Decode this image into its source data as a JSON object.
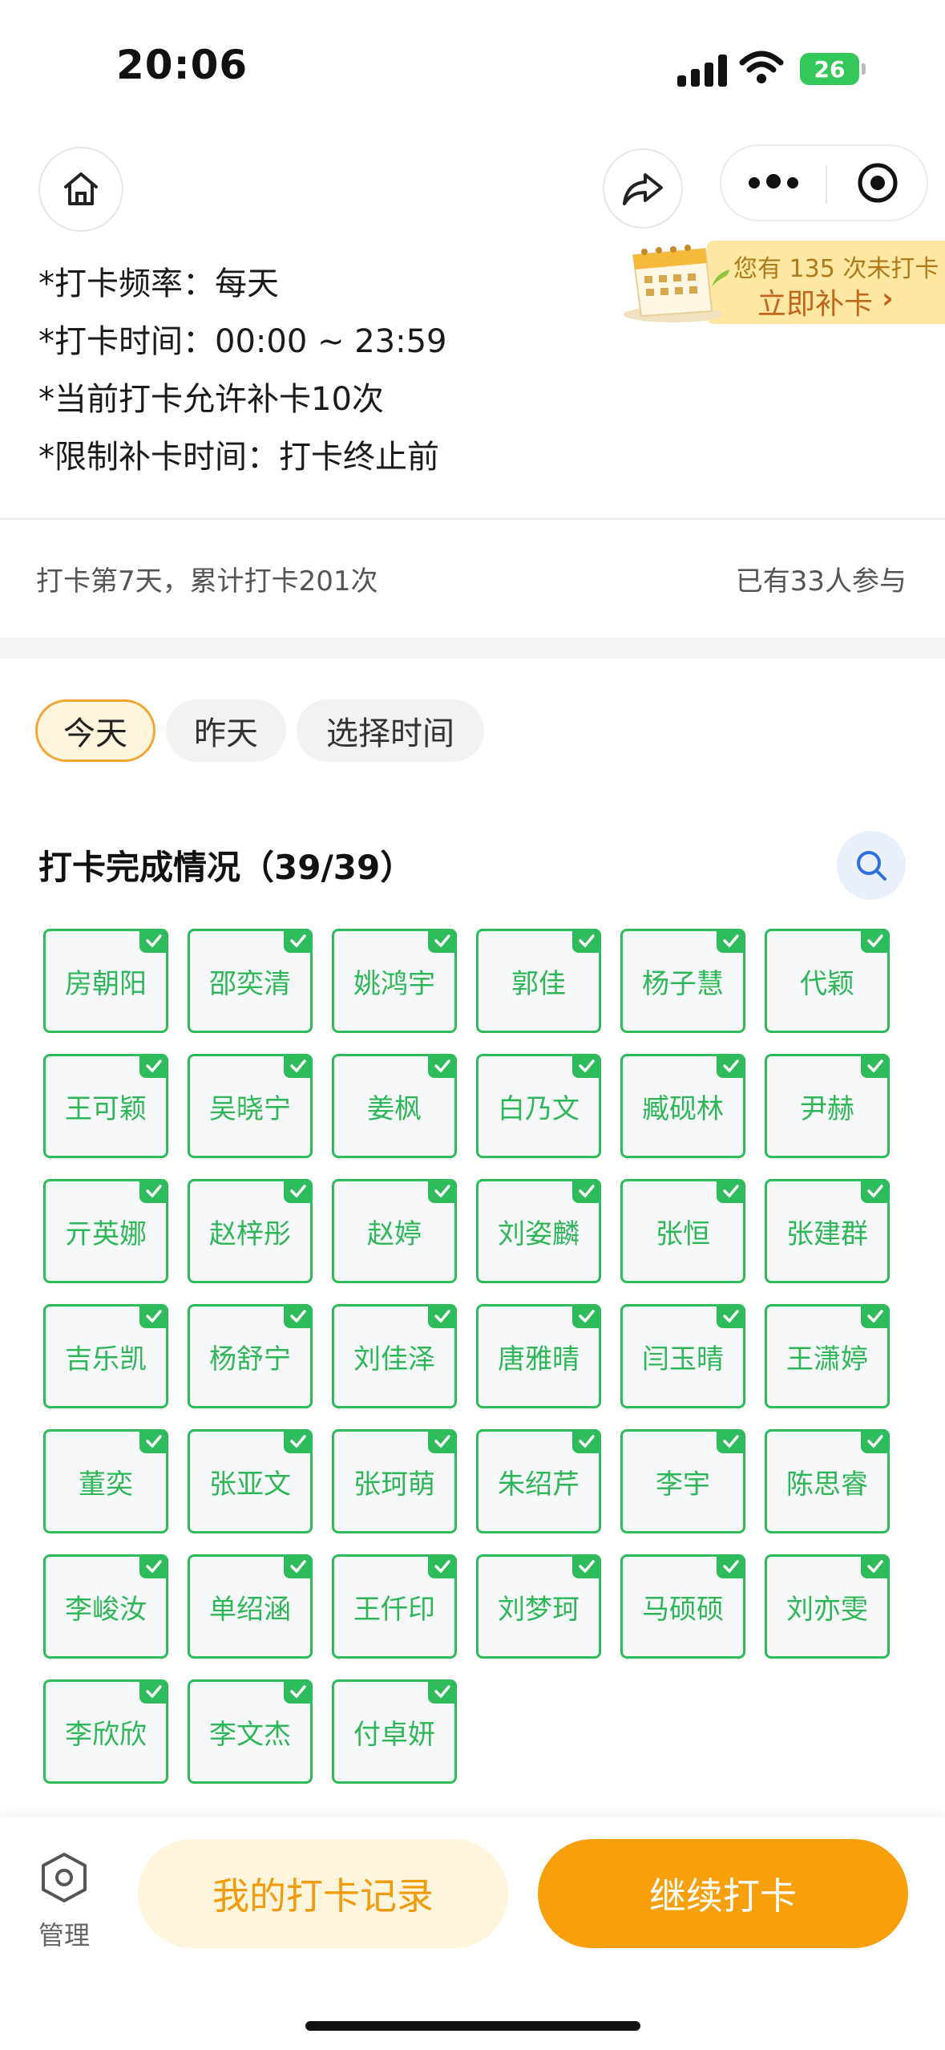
{
  "status_bar": {
    "time": "20:06",
    "battery": "26"
  },
  "rules": [
    "*打卡频率：每天",
    "*打卡时间：00:00 ~ 23:59",
    "*当前打卡允许补卡10次",
    "*限制补卡时间：打卡终止前"
  ],
  "makeup_banner": {
    "line1": "您有 135 次未打卡",
    "line2": "立即补卡"
  },
  "stats": {
    "left": "打卡第7天，累计打卡201次",
    "right": "已有33人参与"
  },
  "day_tabs": {
    "today": "今天",
    "yesterday": "昨天",
    "pick": "选择时间"
  },
  "section": {
    "title": "打卡完成情况（39/39）"
  },
  "names": [
    "房朝阳",
    "邵奕清",
    "姚鸿宇",
    "郭佳",
    "杨子慧",
    "代颖",
    "王可颖",
    "吴晓宁",
    "姜枫",
    "白乃文",
    "臧砚林",
    "尹赫",
    "亓英娜",
    "赵梓彤",
    "赵婷",
    "刘姿麟",
    "张恒",
    "张建群",
    "吉乐凯",
    "杨舒宁",
    "刘佳泽",
    "唐雅晴",
    "闫玉晴",
    "王潇婷",
    "董奕",
    "张亚文",
    "张珂萌",
    "朱绍芹",
    "李宇",
    "陈思睿",
    "李峻汝",
    "单绍涵",
    "王仟印",
    "刘梦珂",
    "马硕硕",
    "刘亦雯",
    "李欣欣",
    "李文杰",
    "付卓妍"
  ],
  "bottom": {
    "manage": "管理",
    "record": "我的打卡记录",
    "continue": "继续打卡"
  },
  "colors": {
    "accent_orange": "#f7a00b",
    "check_green": "#2dbb5c",
    "banner_yellow": "#fde7a3"
  },
  "icons": [
    "home-icon",
    "share-icon",
    "more-icon",
    "close-icon",
    "search-icon",
    "hexagon-settings-icon",
    "check-icon",
    "chevron-right-icon",
    "calendar-icon"
  ]
}
